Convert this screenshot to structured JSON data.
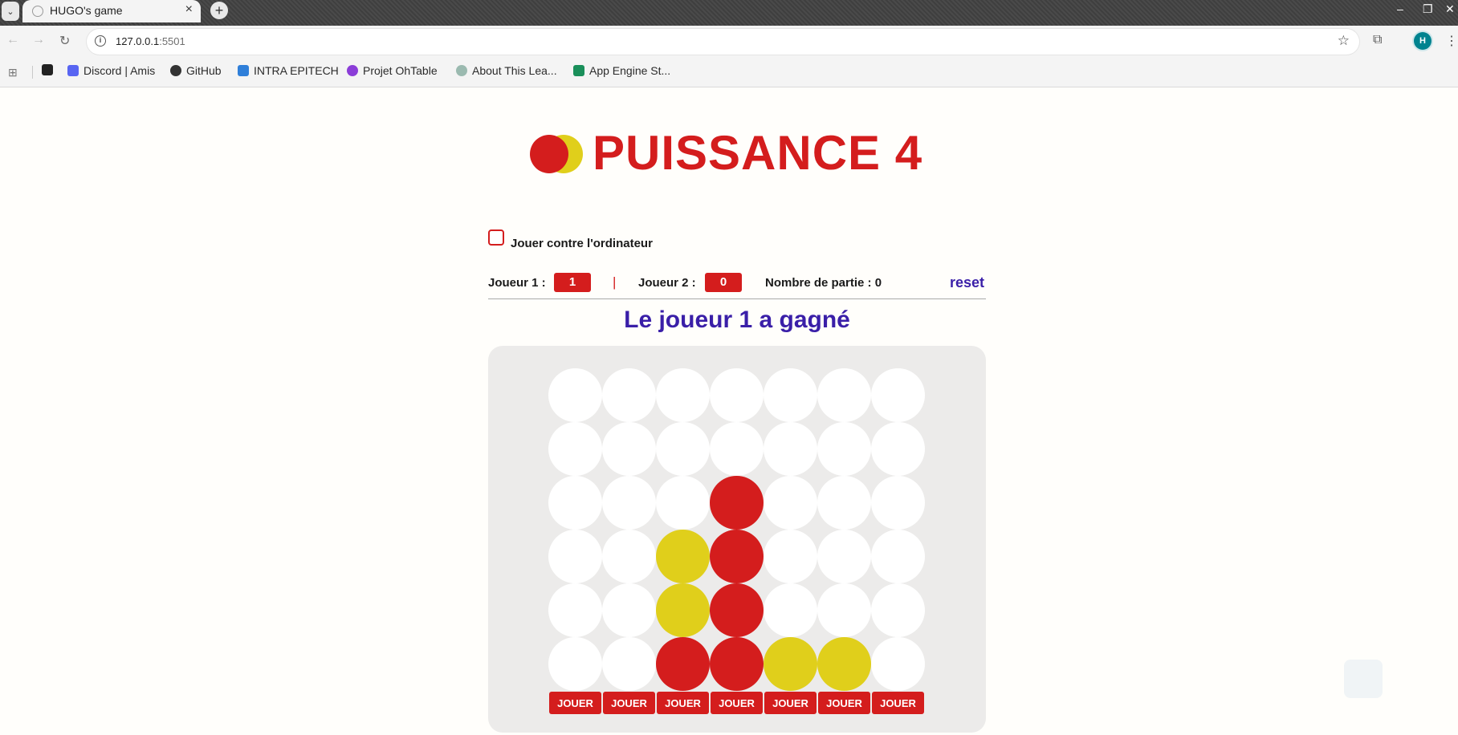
{
  "browser": {
    "tab_title": "HUGO's game",
    "url_host": "127.0.0.1",
    "url_port": ":5501",
    "profile_initial": "H",
    "bookmarks": [
      {
        "label": "Discord | Amis",
        "icon_color": "#5865f2"
      },
      {
        "label": "GitHub",
        "icon_color": "#333333"
      },
      {
        "label": "INTRA EPITECH",
        "icon_color": "#2f7fd9"
      },
      {
        "label": "Projet OhTable",
        "icon_color": "#8b3dd8"
      },
      {
        "label": "About This Lea...",
        "icon_color": "#9bbab0"
      },
      {
        "label": "App Engine St...",
        "icon_color": "#1a8f5a"
      }
    ]
  },
  "game": {
    "title": "PUISSANCE 4",
    "vs_computer_label": "Jouer contre l'ordinateur",
    "vs_computer_checked": false,
    "player1_label": "Joueur 1 :",
    "player1_score": "1",
    "separator": "|",
    "player2_label": "Joueur 2 :",
    "player2_score": "0",
    "games_label": "Nombre de partie : 0",
    "reset_label": "reset",
    "winner_message": "Le joueur 1 a gagné",
    "colors": {
      "red": "#d41d1d",
      "yellow": "#e0cf1b",
      "accent": "#3a1fa8"
    },
    "board": [
      [
        "empty",
        "empty",
        "empty",
        "empty",
        "empty",
        "empty",
        "empty"
      ],
      [
        "empty",
        "empty",
        "empty",
        "empty",
        "empty",
        "empty",
        "empty"
      ],
      [
        "empty",
        "empty",
        "empty",
        "red",
        "empty",
        "empty",
        "empty"
      ],
      [
        "empty",
        "empty",
        "yellow",
        "red",
        "empty",
        "empty",
        "empty"
      ],
      [
        "empty",
        "empty",
        "yellow",
        "red",
        "empty",
        "empty",
        "empty"
      ],
      [
        "empty",
        "empty",
        "red",
        "red",
        "yellow",
        "yellow",
        "empty"
      ]
    ],
    "play_button_label": "JOUER"
  }
}
